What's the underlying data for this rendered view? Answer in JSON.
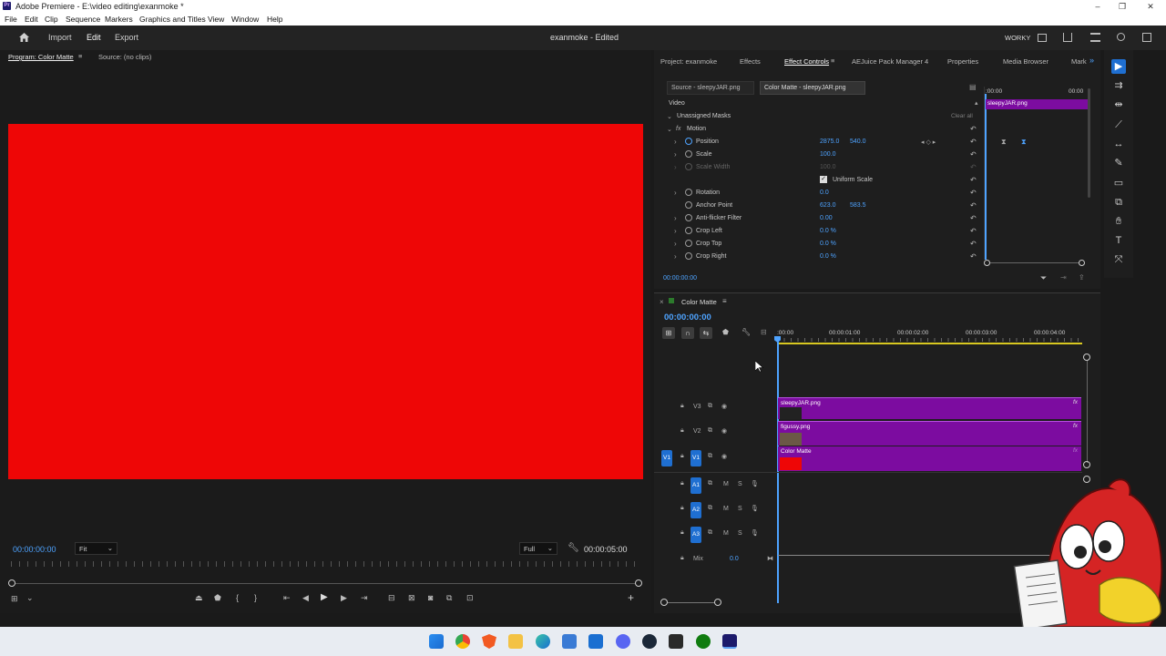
{
  "window": {
    "title": "Adobe Premiere - E:\\video editing\\exanmoke *",
    "app_badge": "Pr",
    "controls": [
      "–",
      "❐",
      "✕"
    ]
  },
  "menu": [
    "File",
    "Edit",
    "Clip",
    "Sequence",
    "Markers",
    "Graphics and Titles",
    "View",
    "Window",
    "Help"
  ],
  "header": {
    "home_icon": "home-icon",
    "nav": [
      "Import",
      "Edit",
      "Export"
    ],
    "project_status": "exanmoke - Edited",
    "workspace_label": "WORKY"
  },
  "program": {
    "tab_program": "Program: Color Matte",
    "tab_source": "Source: (no clips)",
    "timecode": "00:00:00:00",
    "fit": "Fit",
    "quality": "Full",
    "duration": "00:00:05:00",
    "frame_color": "#ee0606"
  },
  "effects_panel": {
    "tabs": [
      "Project: exanmoke",
      "Effects",
      "Effect Controls",
      "AEJuice Pack Manager 4",
      "Properties",
      "Media Browser",
      "Mark"
    ],
    "source_tab": "Source - sleepyJAR.png",
    "clip_tab": "Color Matte - sleepyJAR.png",
    "section_video": "Video",
    "unassigned": "Unassigned Masks",
    "clear_all": "Clear all",
    "motion": "Motion",
    "fx": "fx",
    "uniform_scale": "Uniform Scale",
    "timecode": "00:00:00",
    "ruler_start": ":00:00",
    "ruler_end": "00:00",
    "mini_clip": "sleepyJAR.png",
    "props": [
      {
        "label": "Position",
        "v1": "2875.0",
        "v2": "540.0",
        "icon": true
      },
      {
        "label": "Scale",
        "v1": "100.0",
        "v2": ""
      },
      {
        "label": "Scale Width",
        "v1": "100.0",
        "v2": "",
        "disabled": true
      },
      {
        "label": "Rotation",
        "v1": "0.0",
        "v2": ""
      },
      {
        "label": "Anchor Point",
        "v1": "623.0",
        "v2": "583.5"
      },
      {
        "label": "Anti-flicker Filter",
        "v1": "0.00",
        "v2": ""
      },
      {
        "label": "Crop Left",
        "v1": "0.0 %",
        "v2": ""
      },
      {
        "label": "Crop Top",
        "v1": "0.0 %",
        "v2": ""
      },
      {
        "label": "Crop Right",
        "v1": "0.0 %",
        "v2": ""
      }
    ],
    "panel_timecode": "00:00:00:00"
  },
  "timeline": {
    "sequence_name": "Color Matte",
    "timecode": "00:00:00:00",
    "ruler": [
      ":00:00",
      "00:00:01:00",
      "00:00:02:00",
      "00:00:03:00",
      "00:00:04:00"
    ],
    "video_tracks": [
      {
        "name": "V3",
        "clip": "sleepyJAR.png"
      },
      {
        "name": "V2",
        "clip": "figussy.png"
      },
      {
        "name": "V1",
        "clip": "Color Matte"
      }
    ],
    "source_patch": "V1",
    "audio_tracks": [
      "A1",
      "A2",
      "A3"
    ],
    "mix_label": "Mix",
    "mix_value": "0.0",
    "m": "M",
    "s": "S",
    "clip_fx": "fx"
  },
  "taskbar_icons": [
    "windows-start-icon",
    "chrome-icon",
    "brave-icon",
    "folder-icon",
    "edge-icon",
    "store-icon",
    "mail-icon",
    "discord-icon",
    "steam-icon",
    "epic-icon",
    "xbox-icon",
    "premiere-icon"
  ],
  "colors": {
    "accent": "#4ea3ff",
    "clip_purple": "#7c0ca0",
    "track_blue": "#1f6fd1",
    "playhead": "#4ea3ff"
  }
}
